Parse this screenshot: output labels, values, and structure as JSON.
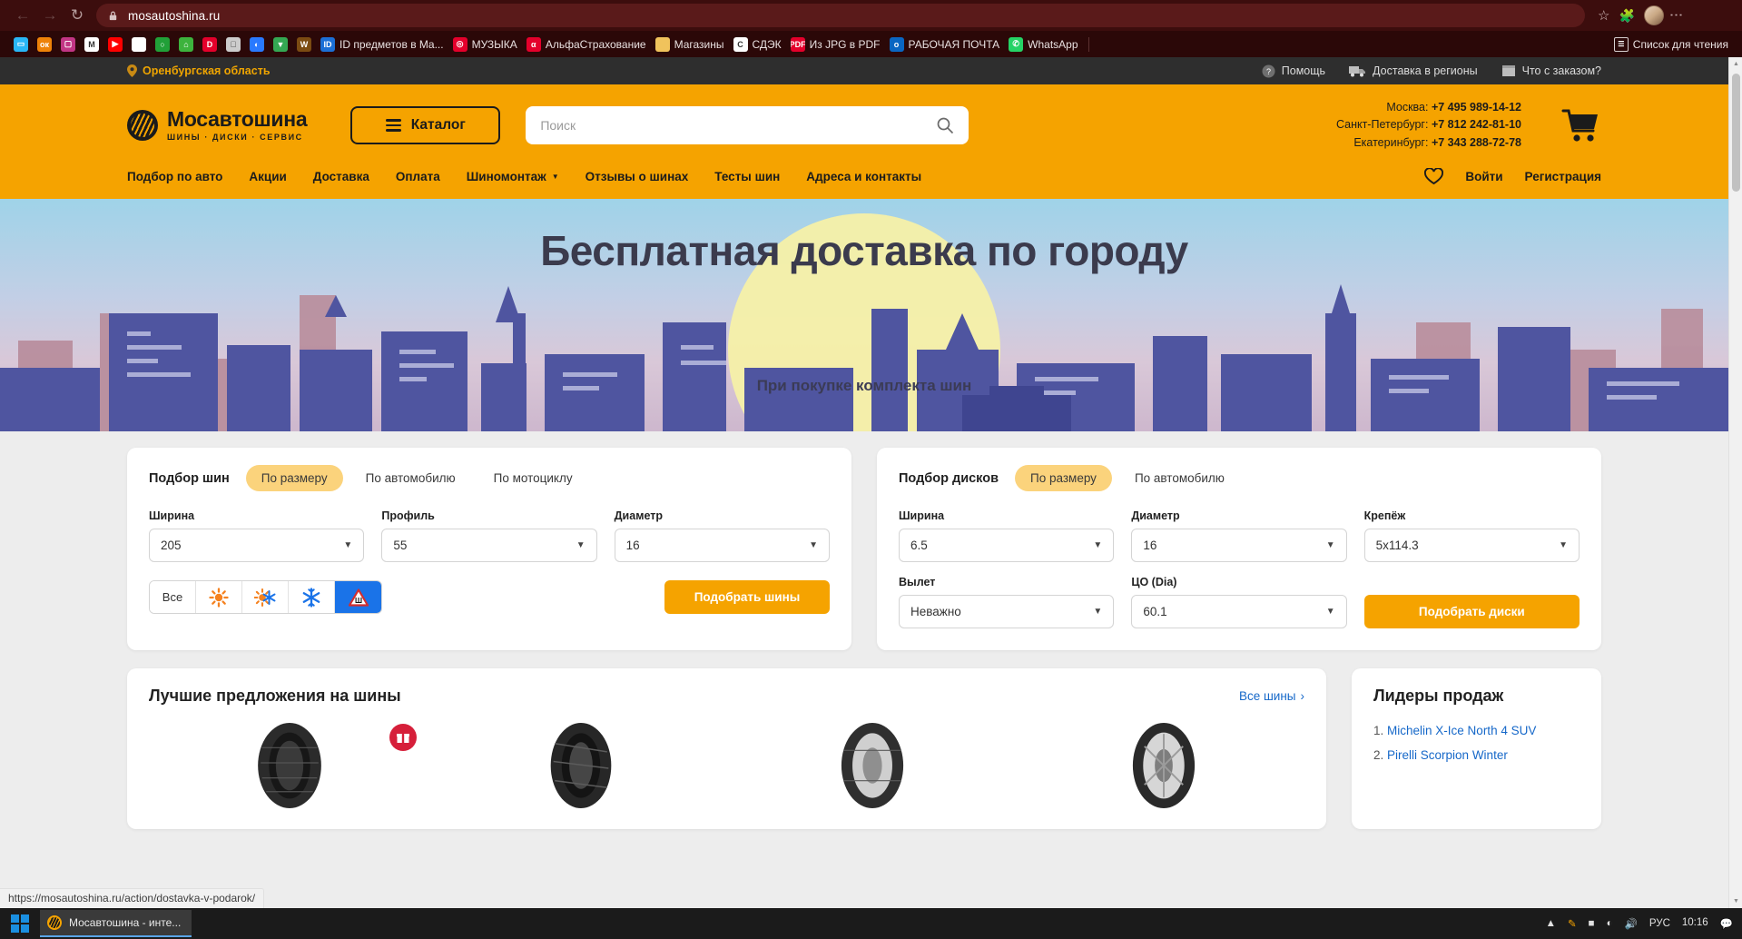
{
  "browser": {
    "url": "mosautoshina.ru",
    "back_icon": "back-arrow-icon",
    "forward_icon": "forward-arrow-icon",
    "reload_icon": "reload-icon",
    "lock_icon": "lock-icon",
    "bookmark_star_icon": "star-icon",
    "extensions_icon": "puzzle-icon",
    "profile_icon": "avatar-icon",
    "menu_icon": "kebab-menu-icon",
    "bookmarks": [
      {
        "label": "",
        "icon": "chat-icon",
        "color": "#29b6f6",
        "glyph": "▭"
      },
      {
        "label": "",
        "icon": "odnoklassniki-icon",
        "color": "#ee8208",
        "glyph": "ок"
      },
      {
        "label": "",
        "icon": "instagram-icon",
        "color": "#c13584",
        "glyph": "▢"
      },
      {
        "label": "",
        "icon": "gmail-icon",
        "color": "#ffffff",
        "glyph": "M"
      },
      {
        "label": "",
        "icon": "youtube-icon",
        "color": "#ff0000",
        "glyph": "▶"
      },
      {
        "label": "",
        "icon": "russia-flag-icon",
        "color": "#ffffff",
        "glyph": ""
      },
      {
        "label": "",
        "icon": "sber-icon",
        "color": "#21a038",
        "glyph": "○"
      },
      {
        "label": "",
        "icon": "avito-icon",
        "color": "#3db33d",
        "glyph": "⌂"
      },
      {
        "label": "",
        "icon": "dns-icon",
        "color": "#e4002b",
        "glyph": "D"
      },
      {
        "label": "",
        "icon": "apple-icon",
        "color": "#cccccc",
        "glyph": ""
      },
      {
        "label": "",
        "icon": "drops-icon",
        "color": "#2979ff",
        "glyph": "◐"
      },
      {
        "label": "",
        "icon": "google-maps-icon",
        "color": "#34a853",
        "glyph": "▼"
      },
      {
        "label": "",
        "icon": "wildberries-icon",
        "color": "#7b4b12",
        "glyph": "W"
      },
      {
        "label": "ID предметов в Ma...",
        "icon": "id-icon",
        "color": "#1c6fd6",
        "glyph": "ID"
      },
      {
        "label": "МУЗЫКА",
        "icon": "music-icon",
        "color": "#e4002b",
        "glyph": "◎"
      },
      {
        "label": "АльфаСтрахование",
        "icon": "alfa-icon",
        "color": "#e4002b",
        "glyph": "α"
      },
      {
        "label": "Магазины",
        "icon": "folder-icon",
        "color": "#f0c35c",
        "glyph": ""
      },
      {
        "label": "СДЭК",
        "icon": "cdek-icon",
        "color": "#ffffff",
        "glyph": "C"
      },
      {
        "label": "Из JPG в PDF",
        "icon": "jpg-to-pdf-icon",
        "color": "#e4002b",
        "glyph": "PDF"
      },
      {
        "label": "РАБОЧАЯ ПОЧТА",
        "icon": "outlook-icon",
        "color": "#0a66c2",
        "glyph": "o"
      },
      {
        "label": "WhatsApp",
        "icon": "whatsapp-icon",
        "color": "#25d366",
        "glyph": "✆"
      }
    ],
    "reading_list": {
      "label": "Список для чтения",
      "icon": "reading-list-icon"
    },
    "status_url": "https://mosautoshina.ru/action/dostavka-v-podarok/"
  },
  "site": {
    "topbar": {
      "geo_icon": "location-pin-icon",
      "geo": "Оренбургская область",
      "links": [
        {
          "label": "Помощь",
          "icon": "question-circle-icon"
        },
        {
          "label": "Доставка в регионы",
          "icon": "truck-icon"
        },
        {
          "label": "Что с заказом?",
          "icon": "box-icon"
        }
      ]
    },
    "header": {
      "logo_name": "Мосавтошина",
      "logo_tagline": "ШИНЫ · ДИСКИ · СЕРВИС",
      "logo_icon": "tire-logo-icon",
      "catalog_button": "Каталог",
      "catalog_icon": "burger-menu-icon",
      "search_placeholder": "Поиск",
      "search_value": "",
      "search_icon": "search-icon",
      "cart_icon": "cart-icon",
      "phones": [
        {
          "city": "Москва:",
          "number": "+7 495 989-14-12"
        },
        {
          "city": "Санкт-Петербург:",
          "number": "+7 812 242-81-10"
        },
        {
          "city": "Екатеринбург:",
          "number": "+7 343 288-72-78"
        }
      ]
    },
    "nav": {
      "items": [
        {
          "label": "Подбор по авто",
          "has_caret": false
        },
        {
          "label": "Акции",
          "has_caret": false
        },
        {
          "label": "Доставка",
          "has_caret": false
        },
        {
          "label": "Оплата",
          "has_caret": false
        },
        {
          "label": "Шиномонтаж",
          "has_caret": true
        },
        {
          "label": "Отзывы о шинах",
          "has_caret": false
        },
        {
          "label": "Тесты шин",
          "has_caret": false
        },
        {
          "label": "Адреса и контакты",
          "has_caret": false
        }
      ],
      "favorites_icon": "heart-icon",
      "login": "Войти",
      "register": "Регистрация"
    },
    "hero": {
      "title": "Бесплатная доставка по городу",
      "subtitle": "При покупке комплекта шин"
    },
    "tire_selector": {
      "title": "Подбор шин",
      "tabs": [
        {
          "label": "По размеру",
          "active": true
        },
        {
          "label": "По автомобилю",
          "active": false
        },
        {
          "label": "По мотоциклу",
          "active": false
        }
      ],
      "fields": [
        {
          "label": "Ширина",
          "value": "205"
        },
        {
          "label": "Профиль",
          "value": "55"
        },
        {
          "label": "Диаметр",
          "value": "16"
        }
      ],
      "seasons": [
        {
          "label": "Все",
          "icon": "all-seasons-text",
          "active": false
        },
        {
          "label": "",
          "icon": "sun-icon",
          "active": false
        },
        {
          "label": "",
          "icon": "sun-snowflake-icon",
          "active": false
        },
        {
          "label": "",
          "icon": "snowflake-icon",
          "active": false
        },
        {
          "label": "",
          "icon": "studded-tire-icon",
          "active": true
        }
      ],
      "cta": "Подобрать шины"
    },
    "disc_selector": {
      "title": "Подбор дисков",
      "tabs": [
        {
          "label": "По размеру",
          "active": true
        },
        {
          "label": "По автомобилю",
          "active": false
        }
      ],
      "fields_row1": [
        {
          "label": "Ширина",
          "value": "6.5"
        },
        {
          "label": "Диаметр",
          "value": "16"
        },
        {
          "label": "Крепёж",
          "value": "5x114.3"
        }
      ],
      "fields_row2": [
        {
          "label": "Вылет",
          "value": "Неважно"
        },
        {
          "label": "ЦО (Dia)",
          "value": "60.1"
        }
      ],
      "cta": "Подобрать диски"
    },
    "offers": {
      "title": "Лучшие предложения на шины",
      "all_link": "Все шины",
      "all_link_icon": "chevron-right-icon",
      "gift_icon": "gift-icon",
      "tires": [
        "tire-1",
        "tire-2",
        "tire-3",
        "tire-4"
      ]
    },
    "leaders": {
      "title": "Лидеры продаж",
      "items": [
        {
          "rank": "1.",
          "label": "Michelin X-Ice North 4 SUV"
        },
        {
          "rank": "2.",
          "label": "Pirelli Scorpion Winter"
        }
      ]
    }
  },
  "taskbar": {
    "start_icon": "windows-start-icon",
    "task_title": "Мосавтошина - инте...",
    "task_icon": "tire-logo-icon",
    "tray": [
      {
        "icon": "chevron-up-icon"
      },
      {
        "icon": "pen-icon"
      },
      {
        "icon": "battery-icon"
      },
      {
        "icon": "wifi-icon"
      },
      {
        "icon": "volume-icon"
      }
    ],
    "language": "РУС",
    "time": "10:16",
    "notifications_icon": "notification-icon"
  },
  "colors": {
    "brand_orange": "#f5a300",
    "chrome_dark_red": "#3c0d0d",
    "accent_blue": "#1a73e8",
    "pill_yellow": "#fbd37c"
  }
}
